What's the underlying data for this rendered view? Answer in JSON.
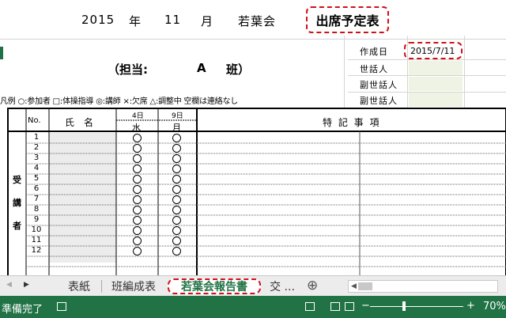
{
  "sheet": {
    "title": {
      "year": "2015",
      "year_unit": "年",
      "month": "11",
      "month_unit": "月",
      "group": "若葉会",
      "doc_type": "出席予定表"
    },
    "tanto": {
      "open": "（担当:",
      "name": "A",
      "han": "班）"
    },
    "info": {
      "created_label": "作成日",
      "created_value": "2015/7/11",
      "sewanin_label": "世話人",
      "fuku1_label": "副世話人",
      "fuku2_label": "副世話人"
    },
    "legend": "凡例 ○:参加者 □:体操指導 ◎:講師 ×:欠席 △:調整中 空欄は連絡なし",
    "table": {
      "no_header": "No.",
      "name_header": "氏　名",
      "day1_date": "4日",
      "day1_weekday": "水",
      "day2_date": "9日",
      "day2_weekday": "月",
      "notes_header": "特 記 事 項",
      "side_label_1": "受",
      "side_label_2": "講",
      "side_label_3": "者",
      "rows": [
        "1",
        "2",
        "3",
        "4",
        "5",
        "6",
        "7",
        "8",
        "9",
        "10",
        "11",
        "12"
      ],
      "marks": "○"
    }
  },
  "tabs": {
    "nav_left": "◀",
    "nav_right": "▶",
    "items": [
      "表紙",
      "班編成表",
      "若葉会報告書",
      "交 ..."
    ],
    "add": "⊕"
  },
  "status": {
    "ready": "準備完了",
    "zoom": "70%",
    "minus": "−",
    "plus": "+"
  },
  "colors": {
    "accent": "#217346",
    "highlight_dash": "#d0101a"
  }
}
